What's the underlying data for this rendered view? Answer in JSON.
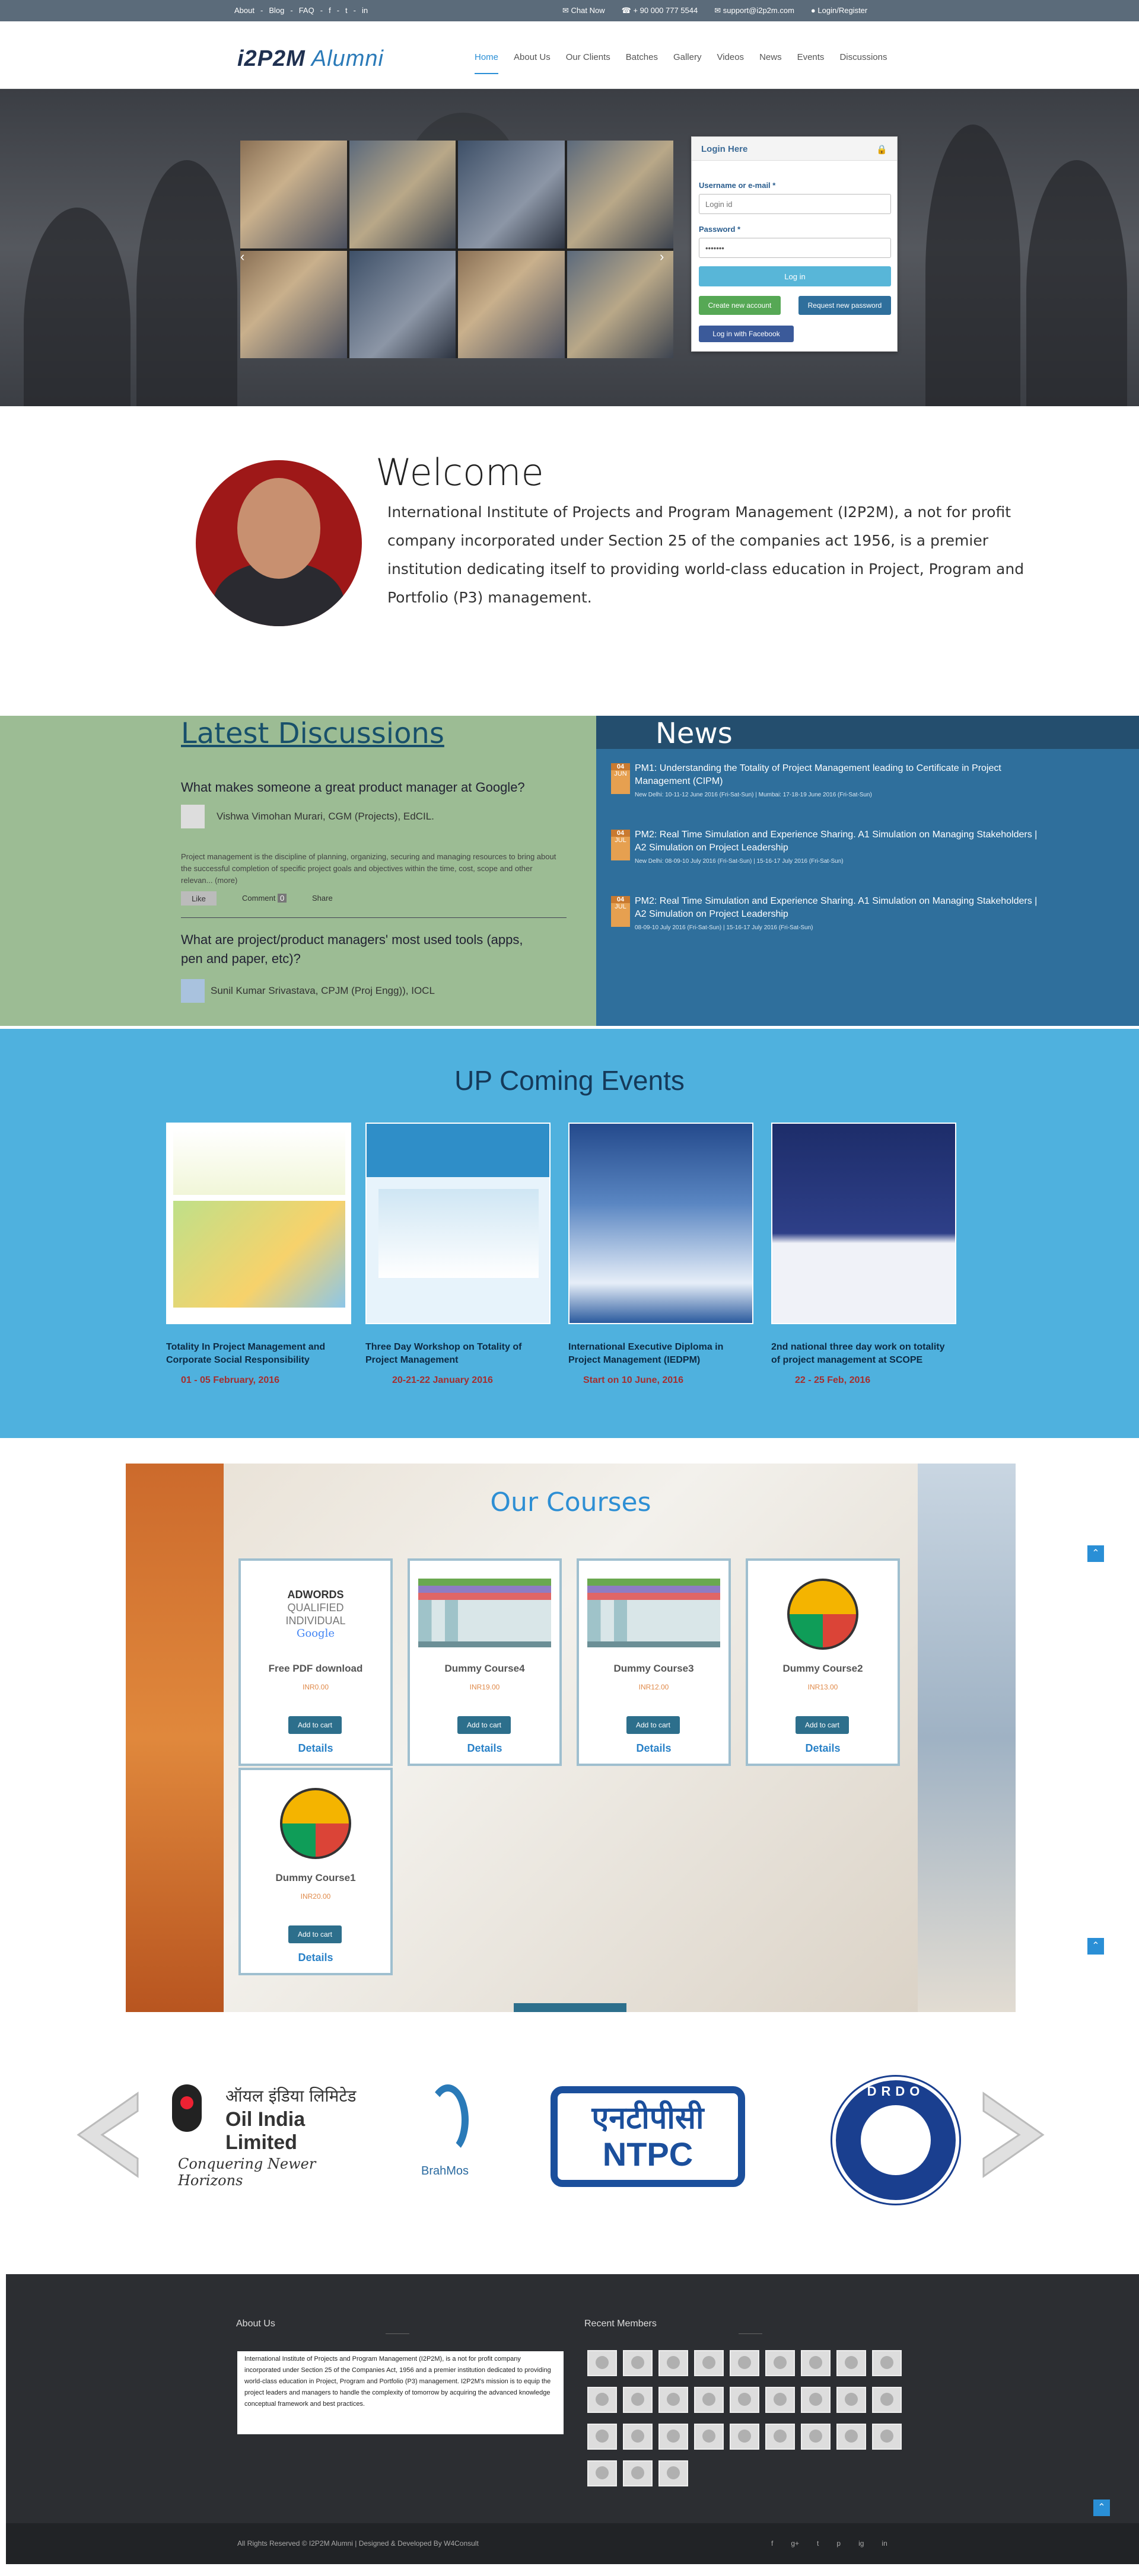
{
  "topbar": {
    "links": [
      "About",
      "-",
      "Blog",
      "-",
      "FAQ",
      "-",
      "f",
      "-",
      "t",
      "-",
      "in"
    ],
    "chat": "Chat Now",
    "phone": "+ 90 000 777 5544",
    "email": "support@i2p2m.com",
    "login": "Login/Register"
  },
  "nav": {
    "logo_main": "i2P2M",
    "logo_sub": "Alumni",
    "items": [
      "Home",
      "About Us",
      "Our Clients",
      "Batches",
      "Gallery",
      "Videos",
      "News",
      "Events",
      "Discussions"
    ]
  },
  "login": {
    "title": "Login Here",
    "user_label": "Username or e-mail *",
    "user_placeholder": "Login id",
    "pass_label": "Password *",
    "pass_value": "•••••••",
    "login_btn": "Log in",
    "create_btn": "Create new account",
    "reset_btn": "Request new password",
    "fb_btn": "Log in with Facebook"
  },
  "welcome": {
    "title": "Welcome",
    "text": "International Institute of Projects and Program Management (I2P2M), a not for profit company incorporated under Section 25 of the companies act 1956, is a premier institution dedicating itself to providing world-class education in Project, Program and Portfolio (P3) management."
  },
  "discussions": {
    "title": "Latest Discussions",
    "q1": "What makes someone a great product manager at Google?",
    "a1_author": "Vishwa Vimohan Murari, CGM (Projects), EdCIL.",
    "a1_text": "Project management is the discipline of planning, organizing, securing and managing resources to bring about the successful completion of specific project goals and objectives within the time, cost, scope and other relevan... (more)",
    "like": "Like",
    "comment": "Comment",
    "comment_count": "0",
    "share": "Share",
    "q2": "What are project/product managers' most used tools (apps, pen and paper, etc)?",
    "a2_author": "Sunil Kumar Srivastava, CPJM (Proj Engg)), IOCL"
  },
  "news": {
    "title": "News",
    "items": [
      {
        "day": "04",
        "mon": "JUN",
        "title": "PM1: Understanding the Totality of Project Management leading to Certificate in Project Management (CIPM)",
        "sub": "New Delhi: 10-11-12 June 2016 (Fri-Sat-Sun) | Mumbai: 17-18-19 June 2016 (Fri-Sat-Sun)"
      },
      {
        "day": "04",
        "mon": "JUL",
        "title": "PM2: Real Time Simulation and Experience Sharing. A1 Simulation on Managing Stakeholders | A2 Simulation on Project Leadership",
        "sub": "New Delhi: 08-09-10 July 2016 (Fri-Sat-Sun) | 15-16-17 July 2016 (Fri-Sat-Sun)"
      },
      {
        "day": "04",
        "mon": "JUL",
        "title": "PM2: Real Time Simulation and Experience Sharing. A1 Simulation on Managing Stakeholders | A2 Simulation on Project Leadership",
        "sub": "08-09-10 July 2016 (Fri-Sat-Sun) | 15-16-17 July 2016 (Fri-Sat-Sun)"
      }
    ]
  },
  "events": {
    "title": "UP Coming Events",
    "items": [
      {
        "title": "Totality In Project Management and Corporate Social Responsibility",
        "date": "01 - 05 February, 2016"
      },
      {
        "title": "Three Day Workshop on Totality of Project Management",
        "date": "20-21-22 January 2016"
      },
      {
        "title": "International Executive Diploma in Project Management (IEDPM)",
        "date": "Start on 10 June, 2016"
      },
      {
        "title": "2nd national three day work on totality of project management at SCOPE",
        "date": "22 - 25 Feb, 2016"
      }
    ]
  },
  "courses": {
    "title": "Our Courses",
    "items": [
      {
        "name": "Free PDF download",
        "price": "INR0.00",
        "cart": "Add to cart",
        "details": "Details"
      },
      {
        "name": "Dummy Course4",
        "price": "INR19.00",
        "cart": "Add to cart",
        "details": "Details"
      },
      {
        "name": "Dummy Course3",
        "price": "INR12.00",
        "cart": "Add to cart",
        "details": "Details"
      },
      {
        "name": "Dummy Course2",
        "price": "INR13.00",
        "cart": "Add to cart",
        "details": "Details"
      },
      {
        "name": "Dummy Course1",
        "price": "INR20.00",
        "cart": "Add to cart",
        "details": "Details"
      }
    ],
    "adwords": [
      "ADWORDS",
      "QUALIFIED",
      "INDIVIDUAL",
      "Google"
    ]
  },
  "partners": {
    "oil_hi": "ऑयल इंडिया लिमिटेड",
    "oil_en": "Oil India Limited",
    "oil_tag": "Conquering Newer Horizons",
    "brahmos": "BrahMos",
    "ntpc_hi": "एनटीपीसी",
    "ntpc_en": "NTPC",
    "drdo": "DRDO"
  },
  "footer": {
    "about_title": "About Us",
    "about_text": "International Institute of Projects and Program Management (I2P2M), is a not for profit company incorporated under Section 25 of the Companies Act, 1956 and a premier institution dedicated to providing world-class education in Project, Program and Portfolio (P3) management. I2P2M's mission is to equip the project leaders and managers to handle the complexity of tomorrow by acquiring the advanced knowledge conceptual framework and best practices.",
    "members_title": "Recent Members",
    "copyright": "All Rights Reserved © I2P2M Alumni | Designed & Developed By W4Consult",
    "social": [
      "f",
      "g+",
      "t",
      "p",
      "ig",
      "in"
    ]
  },
  "colors": {
    "accent": "#2a8fd6",
    "events_bg": "#4fb1de",
    "news_bg": "#2f6f9c",
    "disc_bg": "#9cbc94"
  }
}
